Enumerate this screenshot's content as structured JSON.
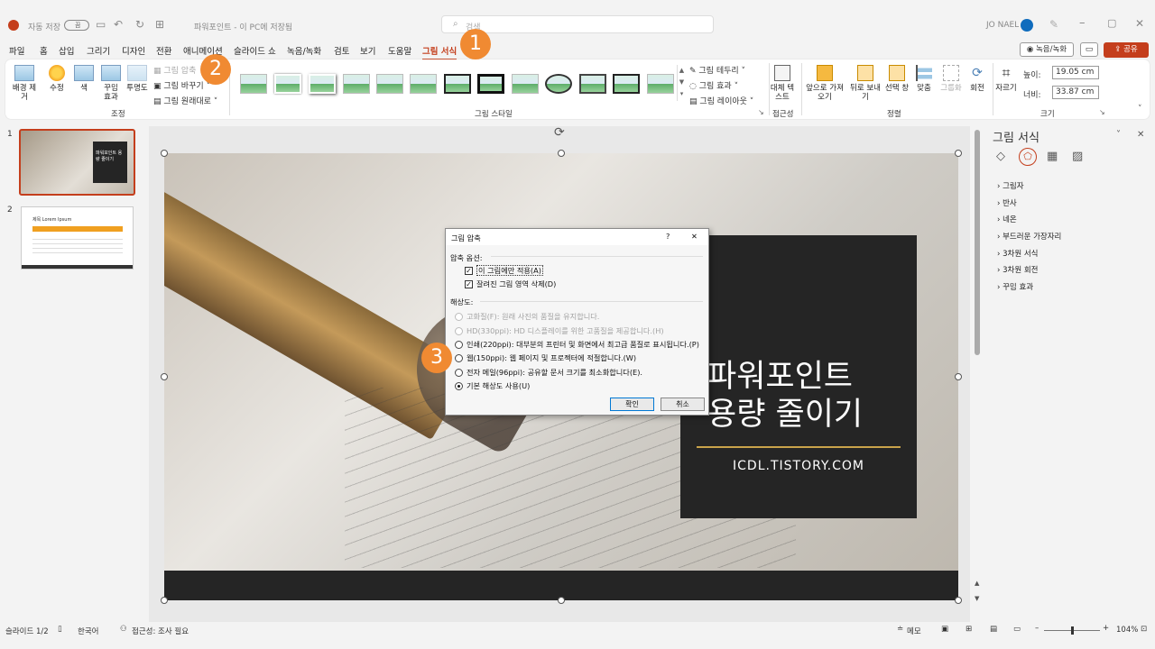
{
  "titlebar": {
    "autosave_label": "자동 저장",
    "autosave_state": "끔",
    "doc_title": "파워포인트 - 이 PC에 저장됨",
    "search_placeholder": "검색",
    "user_name": "JO NAEL"
  },
  "menu": {
    "tabs": [
      "파일",
      "홈",
      "삽입",
      "그리기",
      "디자인",
      "전환",
      "애니메이션",
      "슬라이드 쇼",
      "녹음/녹화",
      "검토",
      "보기",
      "도움말",
      "그림 서식"
    ],
    "active_tab": "그림 서식",
    "record_button": "녹음/녹화",
    "share_button": "공유"
  },
  "ribbon": {
    "adjust": {
      "remove_bg": "배경 제거",
      "corrections": "수정",
      "color": "색",
      "artistic": "꾸밈 효과",
      "transparency": "투명도",
      "compress": "그림 압축",
      "change": "그림 바꾸기",
      "reset": "그림 원래대로",
      "label": "조정"
    },
    "styles": {
      "border": "그림 테두리",
      "effects": "그림 효과",
      "layout": "그림 레이아웃",
      "label": "그림 스타일"
    },
    "accessibility": {
      "alt_text": "대체 텍스트",
      "label": "접근성"
    },
    "arrange": {
      "forward": "앞으로 가져오기",
      "backward": "뒤로 보내기",
      "selection": "선택 창",
      "align": "맞춤",
      "group": "그룹화",
      "rotate": "회전",
      "label": "정렬"
    },
    "size": {
      "crop": "자르기",
      "height_label": "높이:",
      "height_value": "19.05 cm",
      "width_label": "너비:",
      "width_value": "33.87 cm",
      "label": "크기"
    }
  },
  "thumbnails": [
    {
      "number": "1",
      "text": "파워포인트 용량 줄이기"
    },
    {
      "number": "2",
      "text": "제목 Lorem Ipsum"
    }
  ],
  "slide": {
    "title_line1": "파워포인트",
    "title_line2": "용량 줄이기",
    "url": "ICDL.TISTORY.COM"
  },
  "dialog": {
    "title": "그림 압축",
    "help": "?",
    "close": "✕",
    "options_header": "압축 옵션:",
    "opt_apply_only": "이 그림에만 적용(A)",
    "opt_delete_cropped": "잘려진 그림 영역 삭제(D)",
    "resolution_header": "해상도:",
    "res_high": "고화질(F): 원래 사진의 품질을 유지합니다.",
    "res_hd": "HD(330ppi): HD 디스플레이를 위한 고품질을 제공합니다.(H)",
    "res_print": "인쇄(220ppi): 대부분의 프린터 및 화면에서 최고급 품질로 표시됩니다.(P)",
    "res_web": "웹(150ppi): 웹 페이지 및 프로젝터에 적절합니다.(W)",
    "res_email": "전자 메일(96ppi): 공유할 문서 크기를 최소화합니다(E).",
    "res_default": "기본 해상도 사용(U)",
    "ok": "확인",
    "cancel": "취소"
  },
  "format_pane": {
    "title": "그림 서식",
    "items": [
      "그림자",
      "반사",
      "네온",
      "부드러운 가장자리",
      "3차원 서식",
      "3차원 회전",
      "꾸밈 효과"
    ]
  },
  "badges": [
    "1",
    "2",
    "3"
  ],
  "status": {
    "slide": "슬라이드 1/2",
    "language": "한국어",
    "accessibility": "접근성: 조사 필요",
    "notes": "메모",
    "zoom": "104%"
  },
  "colors": {
    "accent": "#c43e1c",
    "badge": "#f08a32",
    "slide_gold": "#c9a24a"
  }
}
